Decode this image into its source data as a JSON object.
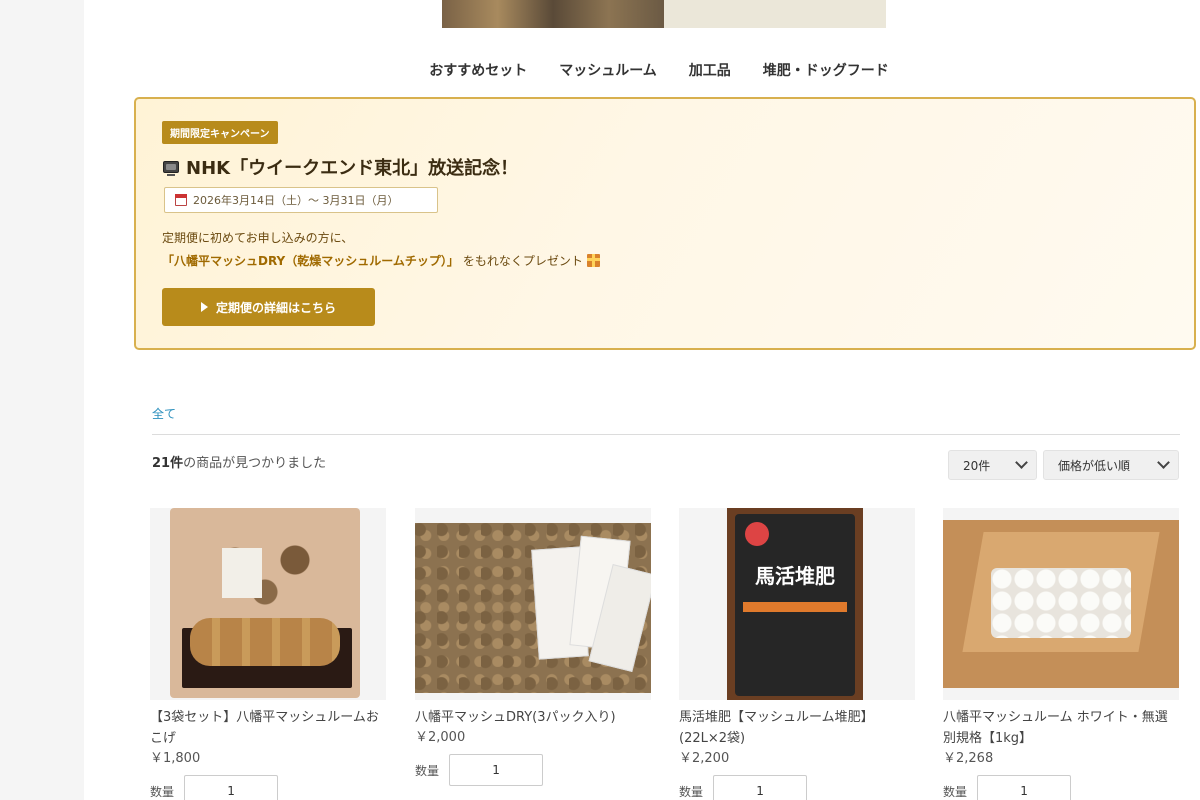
{
  "nav": {
    "items": [
      "おすすめセット",
      "マッシュルーム",
      "加工品",
      "堆肥・ドッグフード"
    ]
  },
  "campaign": {
    "badge": "期間限定キャンペーン",
    "title": "NHK「ウイークエンド東北」放送記念！",
    "title_icon": "tv-icon",
    "date_range": "2026年3月14日（土）～ 3月31日（月）",
    "desc_line1": "定期便に初めてお申し込みの方に、",
    "desc_highlight": "「八幡平マッシュDRY（乾燥マッシュルームチップ）」",
    "desc_line2_rest": "をもれなくプレゼント",
    "cta_label": "定期便の詳細はこちら",
    "accent_color": "#b88b1b"
  },
  "filter": {
    "all_label": "全て"
  },
  "results": {
    "count": "21件",
    "count_suffix": "の商品が見つかりました",
    "per_page_selected": "20件",
    "sort_selected": "価格が低い順"
  },
  "products": [
    {
      "name": "【3袋セット】八幡平マッシュルームおこげ",
      "price": "￥1,800",
      "qty_label": "数量",
      "qty_value": "1"
    },
    {
      "name": "八幡平マッシュDRY(3パック入り)",
      "price": "￥2,000",
      "qty_label": "数量",
      "qty_value": "1"
    },
    {
      "name": "馬活堆肥【マッシュルーム堆肥】(22L×2袋)",
      "price": "￥2,200",
      "qty_label": "数量",
      "qty_value": "1"
    },
    {
      "name": "八幡平マッシュルーム ホワイト・無選別規格【1kg】",
      "price": "￥2,268",
      "qty_label": "数量",
      "qty_value": "1"
    }
  ],
  "product_image_texts": {
    "p3_bag_text": "馬活堆肥"
  }
}
